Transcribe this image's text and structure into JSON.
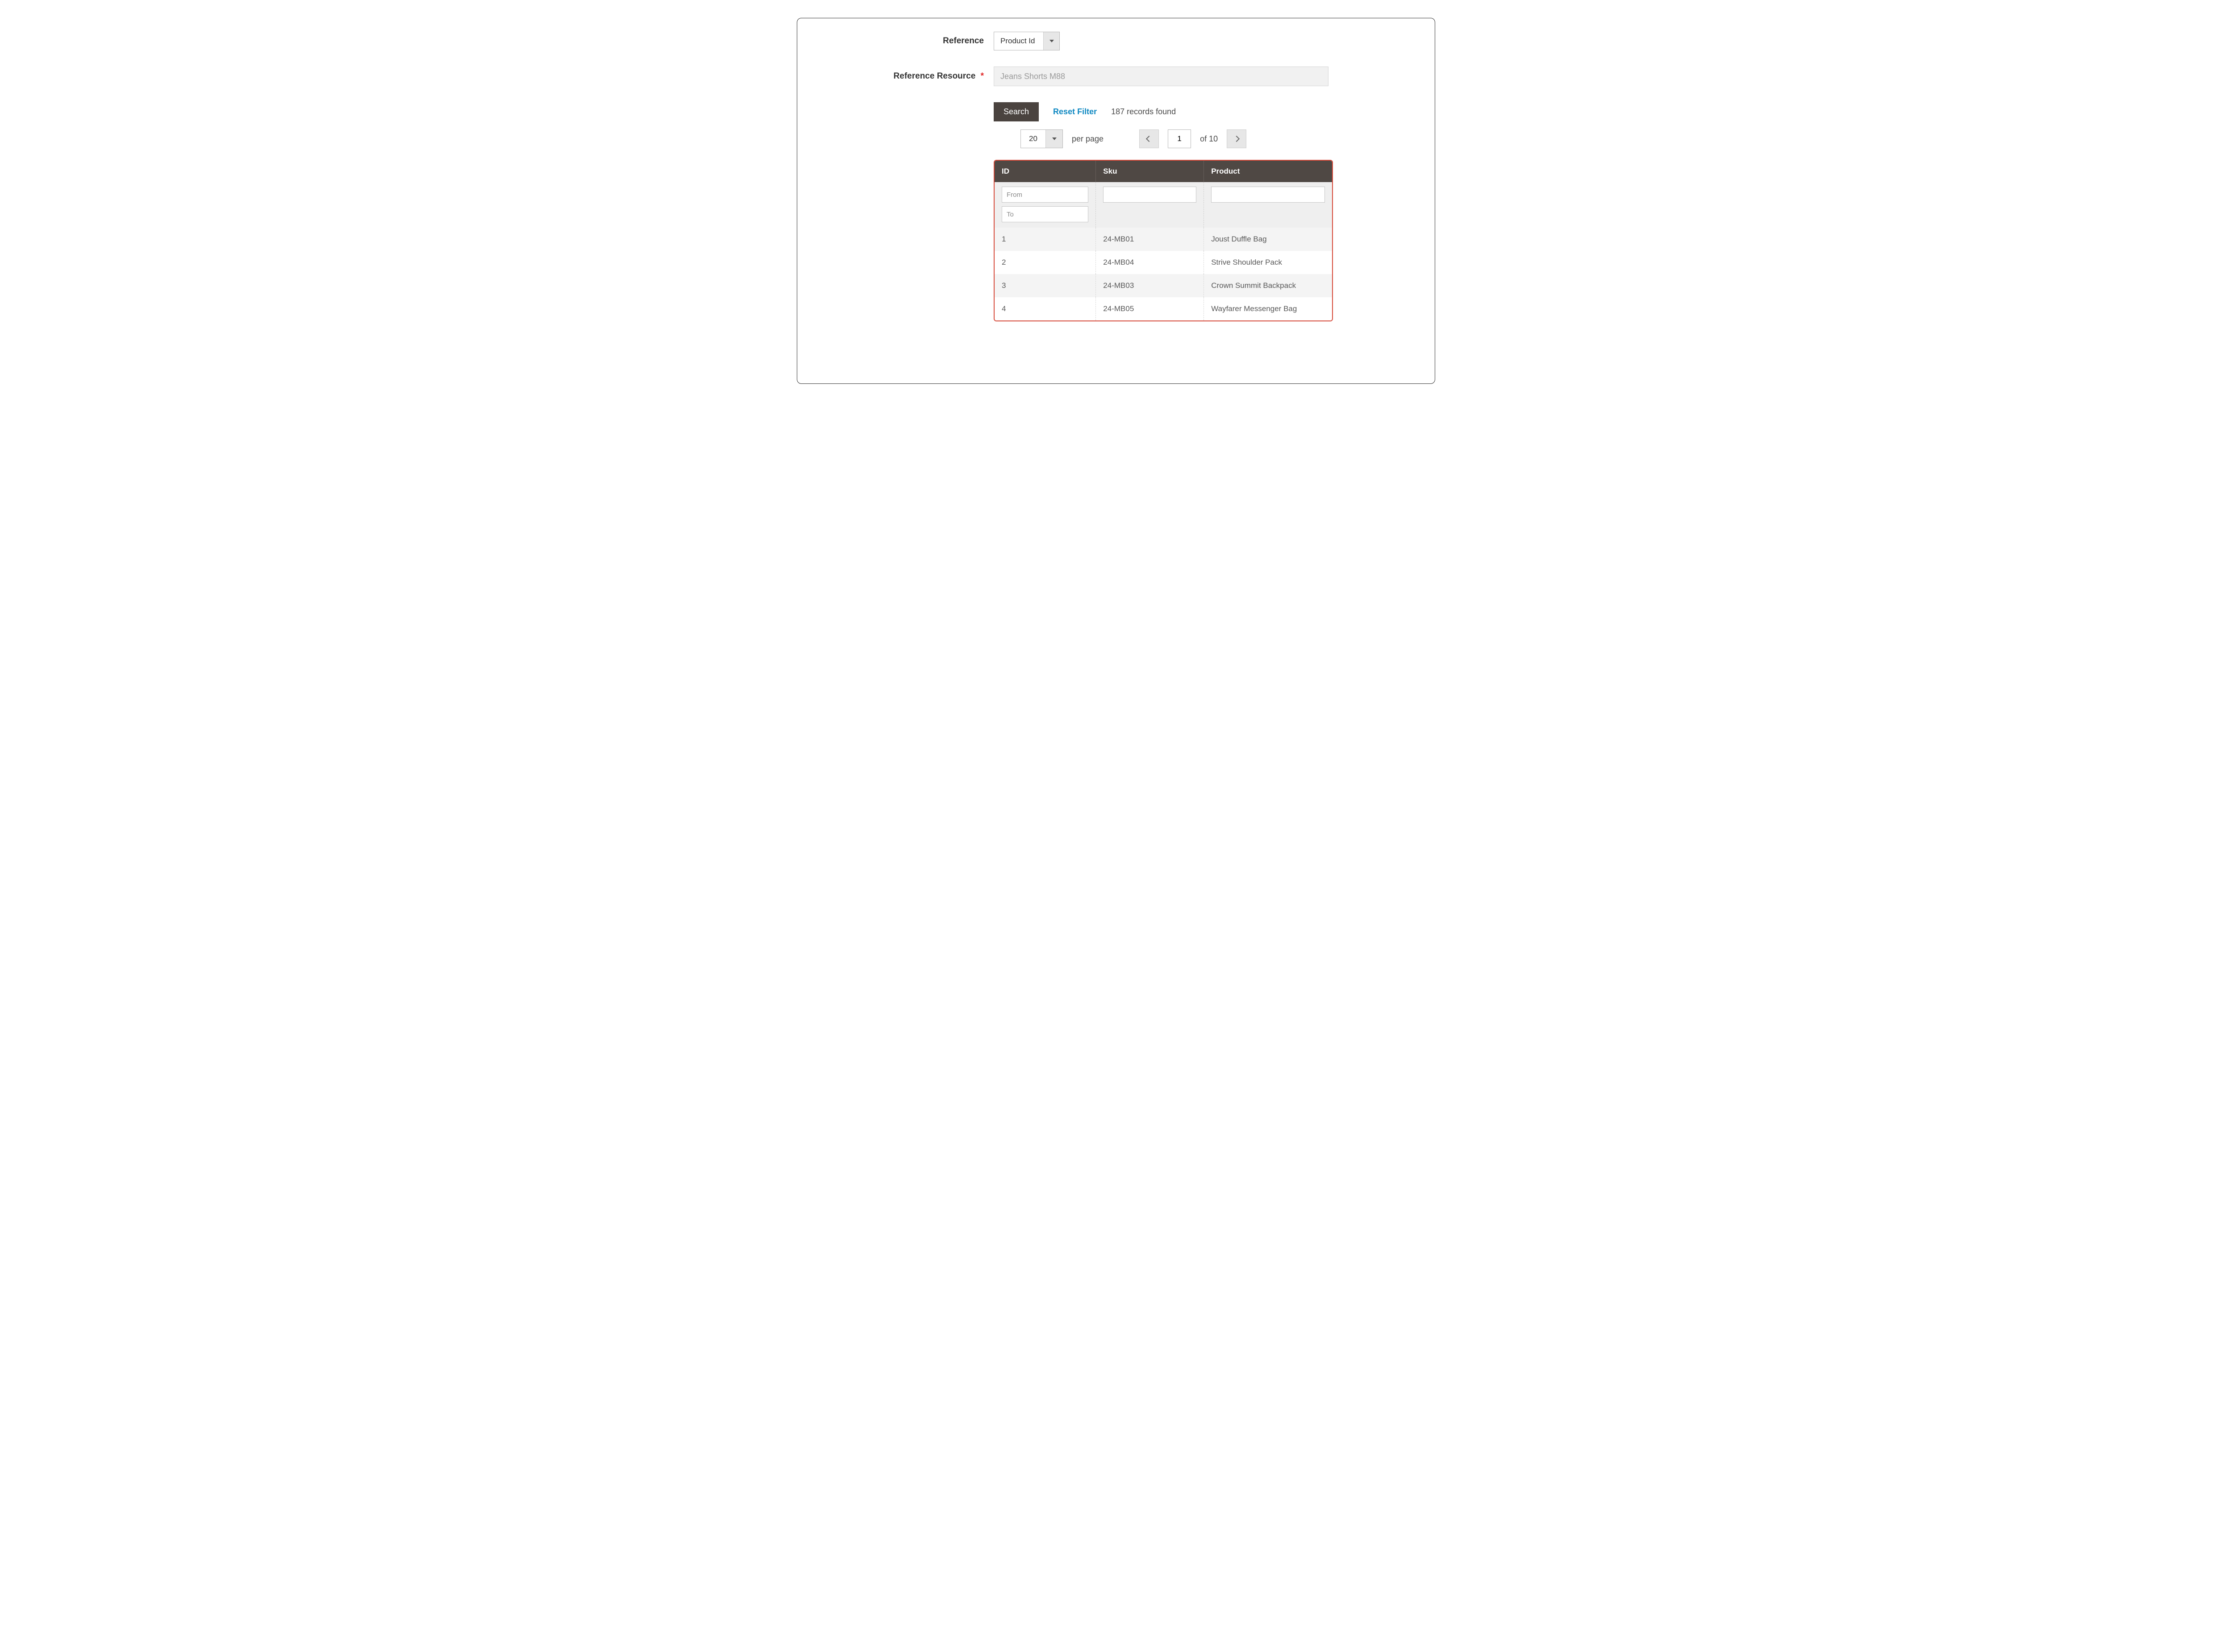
{
  "reference": {
    "label": "Reference",
    "selected": "Product Id"
  },
  "resource": {
    "label": "Reference Resource",
    "required_star": "*",
    "value": "Jeans Shorts M88"
  },
  "actions": {
    "search": "Search",
    "reset": "Reset Filter",
    "records": "187 records found"
  },
  "pager": {
    "per_page_value": "20",
    "per_page_label": "per page",
    "current": "1",
    "of_label": "of 10"
  },
  "grid": {
    "headers": {
      "id": "ID",
      "sku": "Sku",
      "product": "Product"
    },
    "filters": {
      "from": "From",
      "to": "To"
    },
    "rows": [
      {
        "id": "1",
        "sku": "24-MB01",
        "product": "Joust Duffle Bag"
      },
      {
        "id": "2",
        "sku": "24-MB04",
        "product": "Strive Shoulder Pack"
      },
      {
        "id": "3",
        "sku": "24-MB03",
        "product": "Crown Summit Backpack"
      },
      {
        "id": "4",
        "sku": "24-MB05",
        "product": "Wayfarer Messenger Bag"
      }
    ]
  }
}
